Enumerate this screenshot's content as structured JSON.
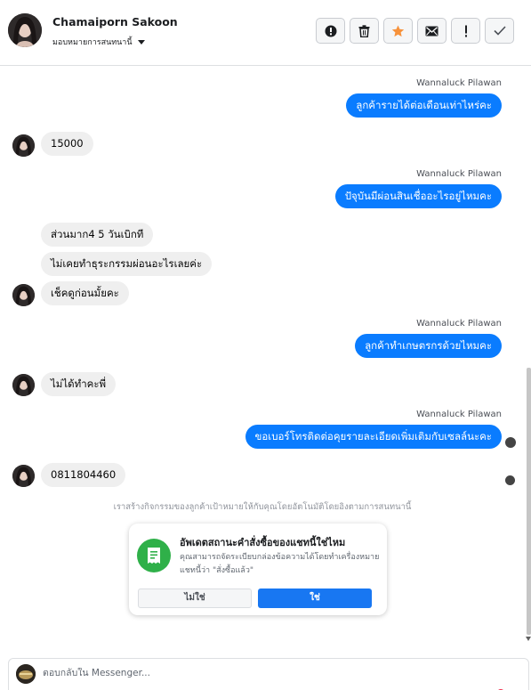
{
  "header": {
    "contact_name": "Chamaiporn Sakoon",
    "assign_label": "มอบหมายการสนทนานี้",
    "actions": [
      {
        "name": "spam-button",
        "icon": "alert-circle-icon"
      },
      {
        "name": "delete-button",
        "icon": "trash-icon"
      },
      {
        "name": "star-button",
        "icon": "star-icon",
        "color": "#f7923b"
      },
      {
        "name": "unread-button",
        "icon": "envelope-icon"
      },
      {
        "name": "follow-up-button",
        "icon": "exclamation-icon"
      },
      {
        "name": "done-button",
        "icon": "check-icon"
      }
    ]
  },
  "messages": [
    {
      "type": "outgoing",
      "sender": "Wannaluck Pilawan",
      "text": "ลูกค้ารายได้ต่อเดือนเท่าไหร่คะ"
    },
    {
      "type": "incoming",
      "text": "15000"
    },
    {
      "type": "outgoing",
      "sender": "Wannaluck Pilawan",
      "text": "ปัจุบันมีผ่อนสินเชื่ออะไรอยู่ไหมคะ"
    },
    {
      "type": "incoming",
      "text": "ส่วนมาก4 5 วันเบิกที"
    },
    {
      "type": "incoming",
      "text": "ไม่เคยทำธุระกรรมผ่อนอะไรเลยค่ะ"
    },
    {
      "type": "incoming",
      "text": "เช็คดูก่อนมั้ยคะ"
    },
    {
      "type": "outgoing",
      "sender": "Wannaluck Pilawan",
      "text": "ลูกค้าทำเกษตรกรด้วยไหมคะ"
    },
    {
      "type": "incoming",
      "text": "ไม่ได้ทำคะพี่"
    },
    {
      "type": "outgoing",
      "sender": "Wannaluck Pilawan",
      "text": "ขอเบอร์โทรติดต่อคุยรายละเอียดเพิ่มเติมกับเซลล์นะคะ"
    },
    {
      "type": "incoming",
      "text": "0811804460"
    }
  ],
  "system_note": "เราสร้างกิจกรรมของลูกค้าเป้าหมายให้กับคุณโดยอัตโนมัติโดยอิงตามการสนทนานี้",
  "status_card": {
    "title": "อัพเดตสถานะคำสั่งซื้อของแชทนี้ใช่ไหม",
    "body": "คุณสามารถจัดระเบียบกล่องข้อความได้โดยทำเครื่องหมายแชทนี้ว่า \"สั่งซื้อแล้ว\"",
    "no_label": "ไม่ใช่",
    "yes_label": "ใช่",
    "icon": "receipt-icon",
    "icon_color": "#2fb049"
  },
  "composer": {
    "placeholder": "ตอบกลับใน Messenger..."
  },
  "colors": {
    "outgoing_bubble": "#0a7cff",
    "incoming_bubble": "#efefef",
    "primary_button": "#1877f2"
  }
}
